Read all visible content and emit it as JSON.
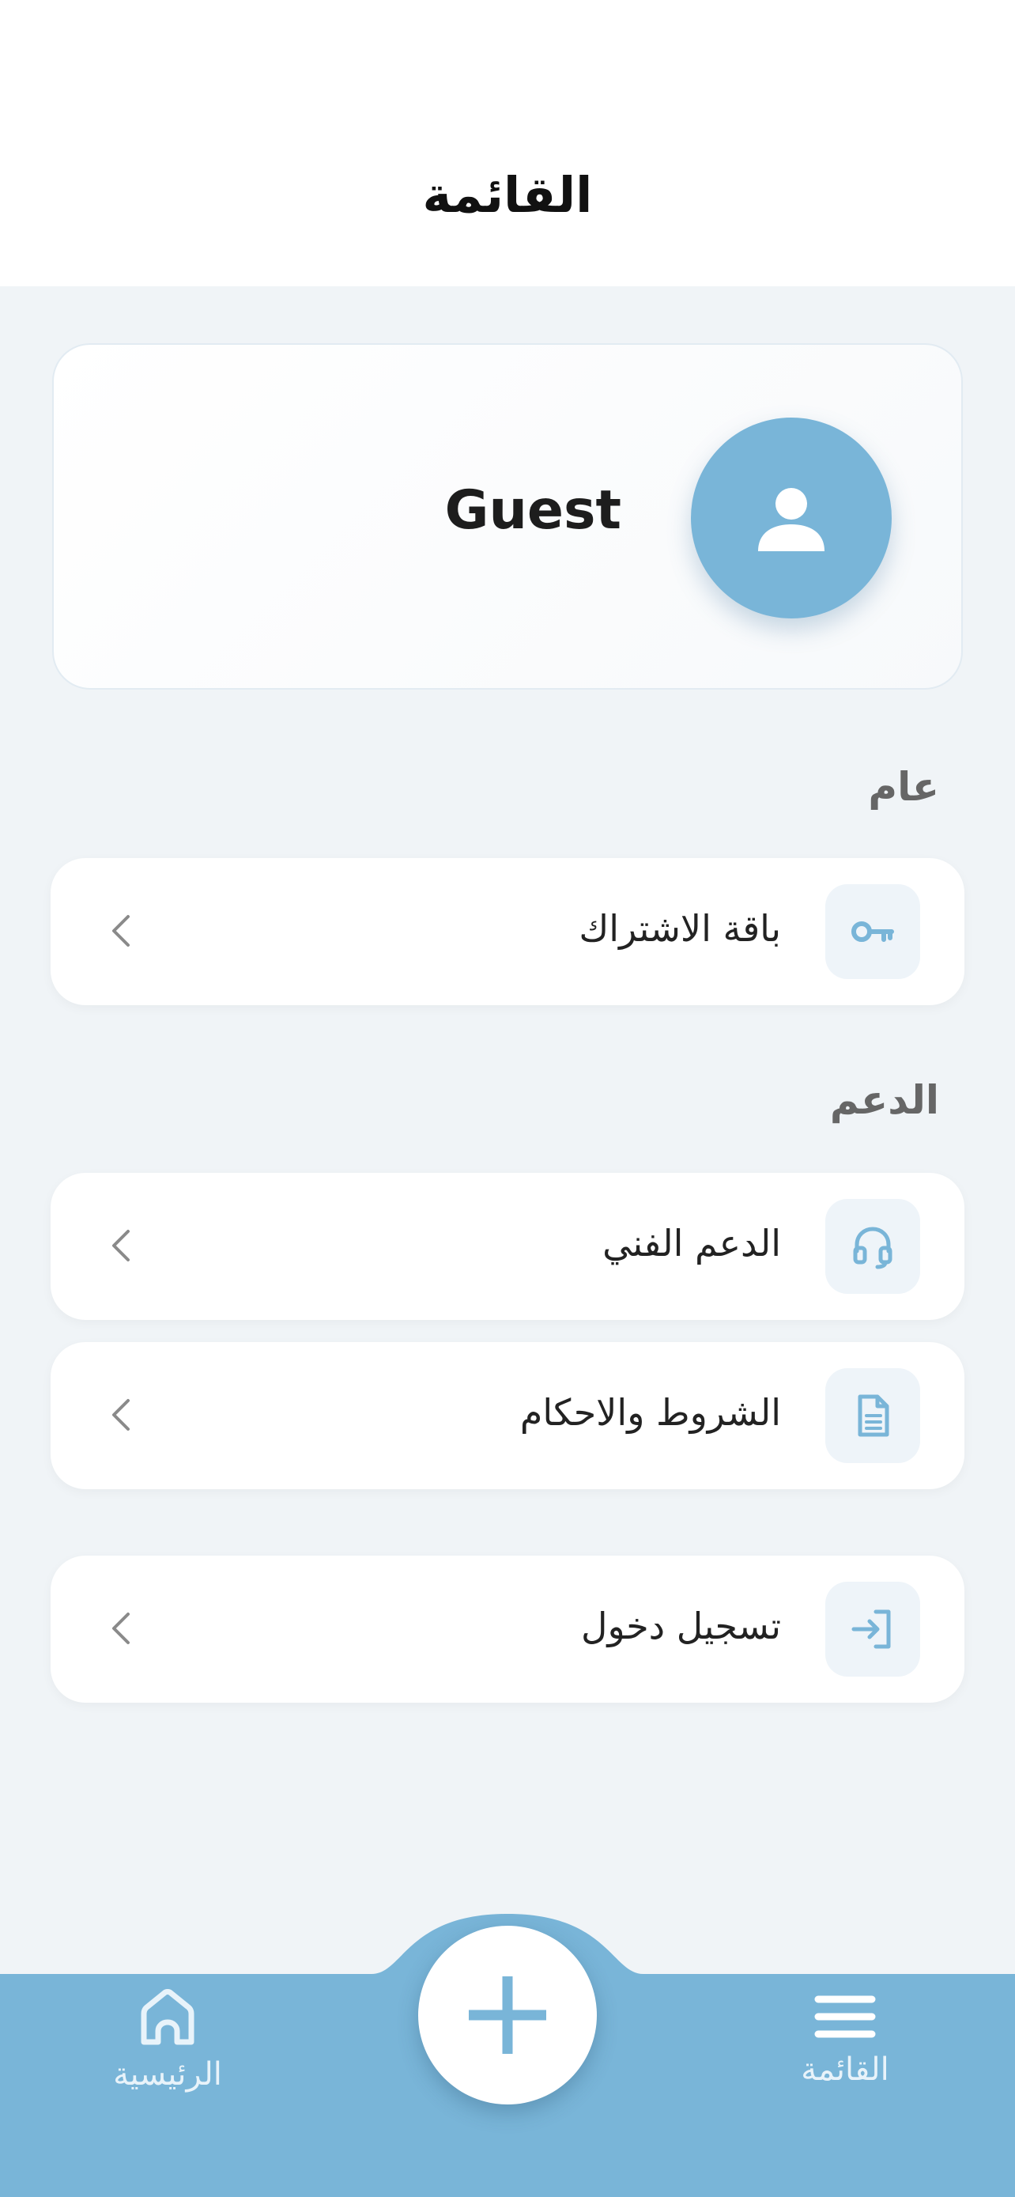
{
  "header": {
    "title": "القائمة"
  },
  "profile": {
    "name": "Guest",
    "avatar_icon": "user-icon"
  },
  "sections": {
    "general": "عام",
    "support": "الدعم"
  },
  "items": [
    {
      "label": "باقة الاشتراك",
      "icon": "key-icon"
    },
    {
      "label": "الدعم الفني",
      "icon": "headset-icon"
    },
    {
      "label": "الشروط والاحكام",
      "icon": "document-icon"
    },
    {
      "label": "تسجيل دخول",
      "icon": "login-icon"
    }
  ],
  "bottom_nav": {
    "home_label": "الرئيسية",
    "menu_label": "القائمة",
    "add_icon": "plus-icon"
  },
  "colors": {
    "accent": "#79b5d8",
    "background": "#f0f4f7",
    "card": "#ffffff"
  }
}
